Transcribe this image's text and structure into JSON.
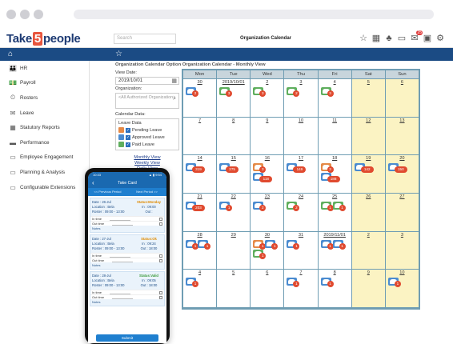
{
  "brand": {
    "logo_a": "Take",
    "logo_num": "5",
    "logo_b": "people"
  },
  "header": {
    "search_placeholder": "Search",
    "title": "Organization Calendar",
    "notify_count": "25"
  },
  "sidebar": {
    "items": [
      {
        "label": "HR",
        "icon": "hr-icon",
        "glyph": "👪"
      },
      {
        "label": "Payroll",
        "icon": "payroll-icon",
        "glyph": "💵"
      },
      {
        "label": "Rosters",
        "icon": "rosters-icon",
        "glyph": "⏲"
      },
      {
        "label": "Leave",
        "icon": "leave-icon",
        "glyph": "✉"
      },
      {
        "label": "Statutory Reports",
        "icon": "reports-icon",
        "glyph": "▦"
      },
      {
        "label": "Performance",
        "icon": "performance-icon",
        "glyph": "▬"
      },
      {
        "label": "Employee Engagement",
        "icon": "engagement-icon",
        "glyph": "▭"
      },
      {
        "label": "Planning & Analysis",
        "icon": "planning-icon",
        "glyph": "▭"
      },
      {
        "label": "Configurable Extensions",
        "icon": "extensions-icon",
        "glyph": "▭"
      }
    ]
  },
  "options": {
    "heading": "Organization Calendar Option Organization Calendar - Monthly View",
    "view_date_label": "View Date:",
    "view_date_value": "2019/10/01",
    "org_label": "Organization:",
    "org_placeholder": "<All Authorized Organization>",
    "cal_data_label": "Calendar Data:",
    "leave_data_label": "Leave Data",
    "legend": [
      {
        "label": "Pending Leave",
        "color": "#e58a47"
      },
      {
        "label": "Approved Leave",
        "color": "#4a8bd0"
      },
      {
        "label": "Paid Leave",
        "color": "#5fae5d"
      }
    ],
    "links": [
      "Monthly View",
      "Weekly View",
      "Daily View"
    ]
  },
  "calendar": {
    "days": [
      "Mon",
      "Tue",
      "Wed",
      "Thu",
      "Fri",
      "Sat",
      "Sun"
    ],
    "weeks": [
      [
        {
          "d": "30",
          "ev": [
            {
              "c": "#4a8bd0",
              "n": "2"
            }
          ]
        },
        {
          "d": "2019/10/01",
          "ev": [
            {
              "c": "#5fae5d",
              "n": "3"
            }
          ]
        },
        {
          "d": "2",
          "ev": [
            {
              "c": "#5fae5d",
              "n": "3"
            }
          ]
        },
        {
          "d": "3",
          "ev": [
            {
              "c": "#5fae5d",
              "n": "2"
            }
          ]
        },
        {
          "d": "4",
          "ev": [
            {
              "c": "#5fae5d",
              "n": "3"
            }
          ]
        },
        {
          "d": "5",
          "ev": []
        },
        {
          "d": "6",
          "ev": []
        }
      ],
      [
        {
          "d": "7",
          "ev": []
        },
        {
          "d": "8",
          "ev": []
        },
        {
          "d": "9",
          "ev": []
        },
        {
          "d": "10",
          "ev": []
        },
        {
          "d": "11",
          "ev": []
        },
        {
          "d": "12",
          "ev": []
        },
        {
          "d": "13",
          "ev": []
        }
      ],
      [
        {
          "d": "14",
          "ev": [
            {
              "c": "#4a8bd0",
              "n": "319"
            }
          ]
        },
        {
          "d": "15",
          "ev": [
            {
              "c": "#4a8bd0",
              "n": "275"
            }
          ]
        },
        {
          "d": "16",
          "ev": [
            {
              "c": "#e58a47",
              "n": "3"
            },
            {
              "c": "#4a8bd0",
              "n": "118"
            }
          ]
        },
        {
          "d": "17",
          "ev": [
            {
              "c": "#4a8bd0",
              "n": "149"
            }
          ]
        },
        {
          "d": "18",
          "ev": [
            {
              "c": "#e58a47",
              "n": "3"
            },
            {
              "c": "#4a8bd0",
              "n": "188"
            }
          ]
        },
        {
          "d": "19",
          "ev": [
            {
              "c": "#4a8bd0",
              "n": "142"
            }
          ]
        },
        {
          "d": "20",
          "ev": [
            {
              "c": "#4a8bd0",
              "n": "150"
            }
          ]
        }
      ],
      [
        {
          "d": "21",
          "ev": [
            {
              "c": "#4a8bd0",
              "n": "203"
            }
          ]
        },
        {
          "d": "22",
          "ev": [
            {
              "c": "#4a8bd0",
              "n": "1"
            }
          ]
        },
        {
          "d": "23",
          "ev": [
            {
              "c": "#4a8bd0",
              "n": "2"
            }
          ]
        },
        {
          "d": "24",
          "ev": [
            {
              "c": "#5fae5d",
              "n": "2"
            }
          ]
        },
        {
          "d": "25",
          "ev": [
            {
              "c": "#5fae5d",
              "n": "1"
            },
            {
              "c": "#5fae5d",
              "n": "1"
            }
          ]
        },
        {
          "d": "26",
          "ev": []
        },
        {
          "d": "27",
          "ev": []
        }
      ],
      [
        {
          "d": "28",
          "ev": [
            {
              "c": "#4a8bd0",
              "n": "1"
            },
            {
              "c": "#4a8bd0",
              "n": "1"
            }
          ]
        },
        {
          "d": "29",
          "ev": []
        },
        {
          "d": "30",
          "ev": [
            {
              "c": "#e58a47",
              "n": "1"
            },
            {
              "c": "#4a8bd0",
              "n": "1"
            },
            {
              "c": "#5fae5d",
              "n": "1"
            }
          ]
        },
        {
          "d": "31",
          "ev": [
            {
              "c": "#4a8bd0",
              "n": "1"
            }
          ]
        },
        {
          "d": "2019/11/01",
          "ev": [
            {
              "c": "#4a8bd0",
              "n": "1"
            },
            {
              "c": "#4a8bd0",
              "n": "1"
            }
          ]
        },
        {
          "d": "2",
          "ev": []
        },
        {
          "d": "3",
          "ev": []
        }
      ],
      [
        {
          "d": "4",
          "ev": [
            {
              "c": "#4a8bd0",
              "n": "1"
            }
          ]
        },
        {
          "d": "5",
          "ev": []
        },
        {
          "d": "6",
          "ev": []
        },
        {
          "d": "7",
          "ev": [
            {
              "c": "#4a8bd0",
              "n": "1"
            }
          ]
        },
        {
          "d": "8",
          "ev": [
            {
              "c": "#4a8bd0",
              "n": "1"
            }
          ]
        },
        {
          "d": "9",
          "ev": []
        },
        {
          "d": "10",
          "ev": [
            {
              "c": "#4a8bd0",
              "n": "1"
            }
          ]
        }
      ]
    ]
  },
  "phone": {
    "status_left": "10:33",
    "status_right": "▲ ▮ 9:54",
    "title": "Take Card",
    "tab_prev": "<< Previous Period",
    "tab_next": "Next Period >>",
    "cards": [
      {
        "date": "Date : 26-Jul",
        "location": "Location : Bela",
        "roster": "Roster : 09:00 - 13:00",
        "status": "Status:Monday",
        "status_cls": "or",
        "in": "In : 09:00",
        "out": "Out :",
        "in_label": "In time",
        "out_label": "Out time",
        "notes": "Notes"
      },
      {
        "date": "Date : 27-Jul",
        "location": "Location : Bela",
        "roster": "Roster : 09:00 - 13:00",
        "status": "Status:Ok",
        "status_cls": "or",
        "in": "In : 09:24",
        "out": "Out : 18:00",
        "in_label": "In time",
        "out_label": "Out time",
        "notes": "Notes"
      },
      {
        "date": "Date : 28-Jul",
        "location": "Location : Bela",
        "roster": "Roster : 09:00 - 13:00",
        "status": "Status:Valid",
        "status_cls": "gr",
        "in": "In : 09:05",
        "out": "Out : 18:00",
        "in_label": "In time",
        "out_label": "Out time",
        "notes": "Notes"
      }
    ],
    "submit": "Submit"
  }
}
